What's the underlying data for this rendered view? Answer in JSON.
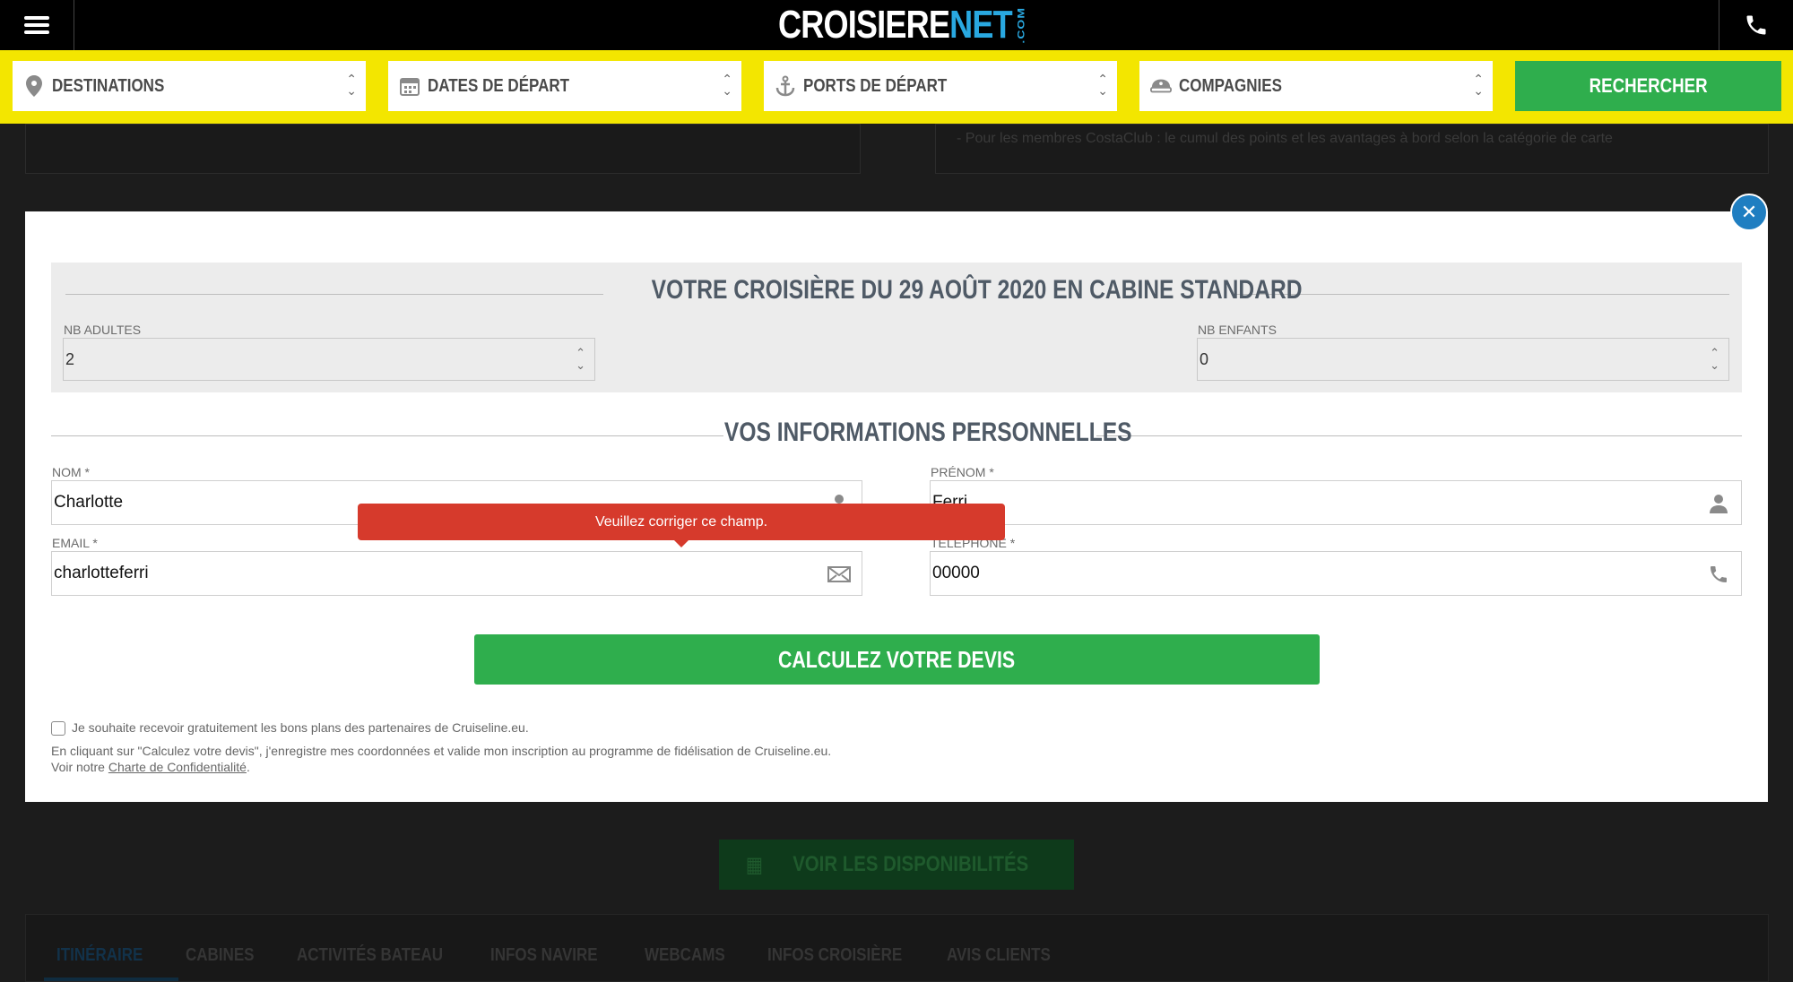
{
  "header": {
    "logo_part1": "CROISIERE",
    "logo_part2": "NET",
    "logo_suffix": ".COM"
  },
  "search": {
    "destinations": "DESTINATIONS",
    "dates": "DATES DE DÉPART",
    "ports": "PORTS DE DÉPART",
    "companies": "COMPAGNIES",
    "button": "RECHERCHER"
  },
  "background": {
    "right_card_text": "- Pour les membres CostaClub : le cumul des points et les avantages à bord selon la catégorie de carte",
    "availability_button": "VOIR LES DISPONIBILITÉS",
    "tabs": [
      "ITINÉRAIRE",
      "CABINES",
      "ACTIVITÉS BATEAU",
      "INFOS NAVIRE",
      "WEBCAMS",
      "INFOS CROISIÈRE",
      "AVIS CLIENTS"
    ]
  },
  "modal": {
    "cruise_title": "VOTRE CROISIÈRE DU 29 AOÛT 2020 EN CABINE STANDARD",
    "adults_label": "NB ADULTES",
    "adults_value": "2",
    "children_label": "NB ENFANTS",
    "children_value": "0",
    "personal_title": "VOS INFORMATIONS PERSONNELLES",
    "nom_label": "NOM *",
    "nom_value": "Charlotte",
    "prenom_label": "PRÉNOM *",
    "prenom_value": "Ferri",
    "email_label": "EMAIL *",
    "email_value": "charlotteferri",
    "phone_label": "TÉLÉPHONE *",
    "phone_value": "00000",
    "error_tooltip": "Veuillez corriger ce champ.",
    "cta": "CALCULEZ VOTRE DEVIS",
    "optin": "Je souhaite recevoir gratuitement les bons plans des partenaires de Cruiseline.eu.",
    "legal_1": "En cliquant sur \"Calculez votre devis\", j'enregistre mes coordonnées et valide mon inscription au programme de fidélisation de Cruiseline.eu.",
    "legal_2_prefix": "Voir notre ",
    "legal_2_link": "Charte de Confidentialité",
    "legal_2_suffix": "."
  },
  "colors": {
    "accent_yellow": "#f3e600",
    "green": "#2fae4d",
    "blue": "#1f7ec1",
    "error_red": "#d63a2c"
  }
}
